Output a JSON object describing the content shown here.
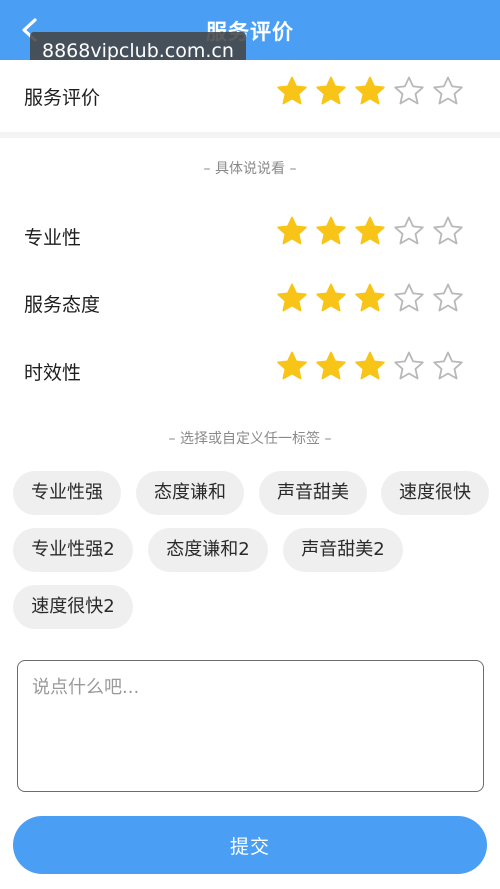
{
  "header": {
    "title": "服务评价",
    "back_icon": "chevron-left-icon",
    "background": "#4a9ff5"
  },
  "watermark": {
    "text": "8868vipclub.com.cn"
  },
  "overall": {
    "label": "服务评价",
    "rating": 3,
    "max": 5
  },
  "details_label": "– 具体说说看 –",
  "details": [
    {
      "label": "专业性",
      "rating": 3,
      "max": 5
    },
    {
      "label": "服务态度",
      "rating": 3,
      "max": 5
    },
    {
      "label": "时效性",
      "rating": 3,
      "max": 5
    }
  ],
  "tags_label": "– 选择或自定义任一标签 –",
  "tags": [
    "专业性强",
    "态度谦和",
    "声音甜美",
    "速度很快",
    "专业性强2",
    "态度谦和2",
    "声音甜美2",
    "速度很快2"
  ],
  "comment": {
    "placeholder": "说点什么吧...",
    "value": ""
  },
  "submit": {
    "label": "提交"
  },
  "colors": {
    "star_filled": "#f9c418",
    "star_empty_stroke": "#b8b8b8",
    "accent": "#4a9ff5"
  }
}
